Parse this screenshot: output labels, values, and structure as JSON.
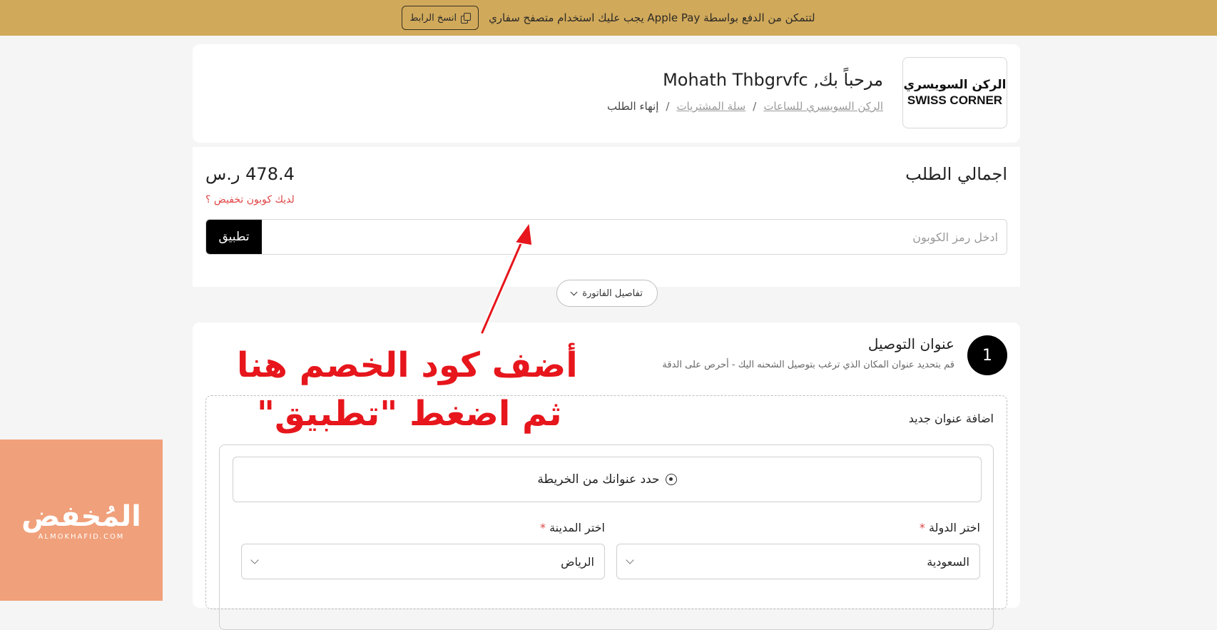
{
  "banner": {
    "message": "لتتمكن من الدفع بواسطة Apple Pay يجب عليك استخدام متصفح سفاري",
    "copy_label": "انسخ الرابط"
  },
  "header": {
    "logo_ar": "الركن السويسري",
    "logo_en": "SWISS CORNER",
    "welcome": "مرحباً بك, Mohath Thbgrvfc",
    "breadcrumb": [
      "الركن السويسري للساعات",
      "سلة المشتريات",
      "إنهاء الطلب"
    ],
    "separator": "/"
  },
  "summary": {
    "title": "اجمالي الطلب",
    "amount": "478.4 ر.س",
    "coupon_question": "لديك كوبون تخفيض ؟",
    "coupon_placeholder": "ادخل رمز الكوبون",
    "apply_label": "تطبيق",
    "invoice_details_label": "تفاصيل الفاتورة"
  },
  "delivery": {
    "step_number": "1",
    "title": "عنوان التوصيل",
    "subtitle": "قم بتحديد عنوان المكان الذي ترغب بتوصيل الشحنه اليك - أحرص على الدقة",
    "new_address_label": "اضافة عنوان جديد",
    "map_button_label": "حدد عنوانك من الخريطة",
    "country_label": "اختر الدولة",
    "country_value": "السعودية",
    "city_label": "اختر المدينة",
    "city_value": "الرياض",
    "required_mark": "*"
  },
  "annotation": {
    "line1": "أضف كود الخصم هنا",
    "line2": "ثم اضغط \"تطبيق\"",
    "color": "#e6161c"
  },
  "watermark": {
    "name_ar": "المُخفض",
    "name_en": "ALMOKHAFID.COM"
  },
  "colors": {
    "banner": "#d0a95b",
    "accent_black": "#000000",
    "link_red": "#e04545",
    "watermark_bg": "#f0a07a"
  }
}
